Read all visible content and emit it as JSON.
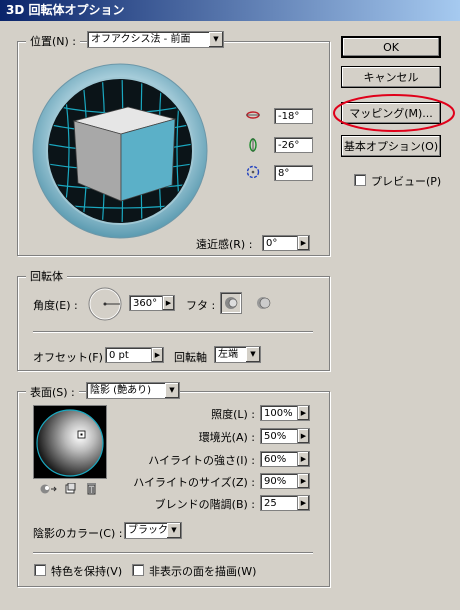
{
  "window": {
    "title": "3D 回転体オプション"
  },
  "buttons": {
    "ok": "OK",
    "cancel": "キャンセル",
    "mapping": "マッピング(M)...",
    "basic_options": "基本オプション(O)"
  },
  "preview": {
    "label": "プレビュー(P)",
    "checked": false
  },
  "position": {
    "label": "位置(N) :",
    "selected": "オフアクシス法 - 前面",
    "rot_x": "-18°",
    "rot_y": "-26°",
    "rot_z": "8°",
    "perspective_label": "遠近感(R) :",
    "perspective": "0°"
  },
  "revolve": {
    "title": "回転体",
    "angle_label": "角度(E) :",
    "angle": "360°",
    "cap_label": "フタ :",
    "offset_label": "オフセット(F) :",
    "offset": "0 pt",
    "axis_label": "回転軸",
    "axis": "左端"
  },
  "surface": {
    "label": "表面(S) :",
    "selected": "陰影 (艶あり)",
    "intensity_label": "照度(L) :",
    "intensity": "100%",
    "ambient_label": "環境光(A) :",
    "ambient": "50%",
    "highlight_intensity_label": "ハイライトの強さ(I) :",
    "highlight_intensity": "60%",
    "highlight_size_label": "ハイライトのサイズ(Z) :",
    "highlight_size": "90%",
    "blend_steps_label": "ブレンドの階調(B) :",
    "blend_steps": "25",
    "shade_color_label": "陰影のカラー(C) :",
    "shade_color": "ブラック"
  },
  "options": {
    "preserve_spot_label": "特色を保持(V)",
    "draw_hidden_label": "非表示の面を描画(W)"
  },
  "colors": {
    "highlight_circle": "#e0001a",
    "titlebar_start": "#0a246a",
    "cube_front": "#5bb0c8"
  }
}
